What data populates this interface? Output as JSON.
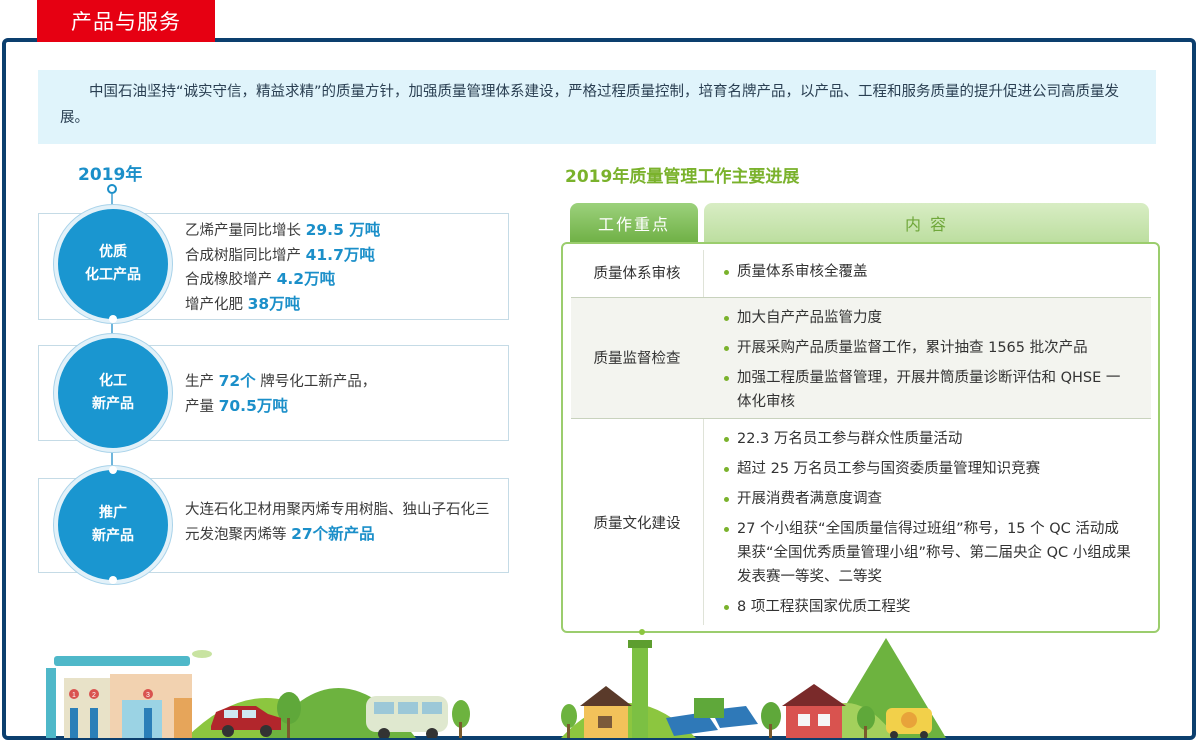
{
  "header": {
    "title": "产品与服务"
  },
  "intro": "中国石油坚持“诚实守信，精益求精”的质量方针，加强质量管理体系建设，严格过程质量控制，培育名牌产品，以产品、工程和服务质量的提升促进公司高质量发展。",
  "left": {
    "year": "2019年",
    "cards": [
      {
        "circle": [
          "优质",
          "化工产品"
        ],
        "lines": [
          {
            "pre": "乙烯产量同比增长 ",
            "hl": "29.5 万吨",
            "post": ""
          },
          {
            "pre": "合成树脂同比增产 ",
            "hl": "41.7万吨",
            "post": ""
          },
          {
            "pre": "合成橡胶增产 ",
            "hl": "4.2万吨",
            "post": ""
          },
          {
            "pre": "增产化肥 ",
            "hl": "38万吨",
            "post": ""
          }
        ]
      },
      {
        "circle": [
          "化工",
          "新产品"
        ],
        "lines": [
          {
            "pre": "生产 ",
            "hl": "72个",
            "post": " 牌号化工新产品，"
          },
          {
            "pre": "产量 ",
            "hl": "70.5万吨",
            "post": ""
          }
        ]
      },
      {
        "circle": [
          "推广",
          "新产品"
        ],
        "lines": [
          {
            "pre": "大连石化卫材用聚丙烯专用树脂、独山子石化三",
            "hl": "",
            "post": ""
          },
          {
            "pre": "元发泡聚丙烯等 ",
            "hl": "27个新产品",
            "post": ""
          }
        ]
      }
    ]
  },
  "right": {
    "title": "2019年质量管理工作主要进展",
    "headers": {
      "focus": "工作重点",
      "content": "内 容"
    },
    "rows": [
      {
        "name": "质量体系审核",
        "items": [
          "质量体系审核全覆盖"
        ]
      },
      {
        "name": "质量监督检查",
        "items": [
          "加大自产产品监管力度",
          "开展采购产品质量监督工作，累计抽查 1565 批次产品",
          "加强工程质量监督管理，开展井筒质量诊断评估和 QHSE 一体化审核"
        ]
      },
      {
        "name": "质量文化建设",
        "items": [
          "22.3 万名员工参与群众性质量活动",
          "超过 25 万名员工参与国资委质量管理知识竞赛",
          "开展消费者满意度调查",
          "27 个小组获“全国质量信得过班组”称号，15 个 QC 活动成果获“全国优秀质量管理小组”称号、第二届央企 QC 小组成果发表赛一等奖、二等奖",
          "8 项工程获国家优质工程奖"
        ]
      }
    ]
  },
  "scenery": {
    "pump_numbers": [
      "1",
      "2",
      "3"
    ]
  }
}
